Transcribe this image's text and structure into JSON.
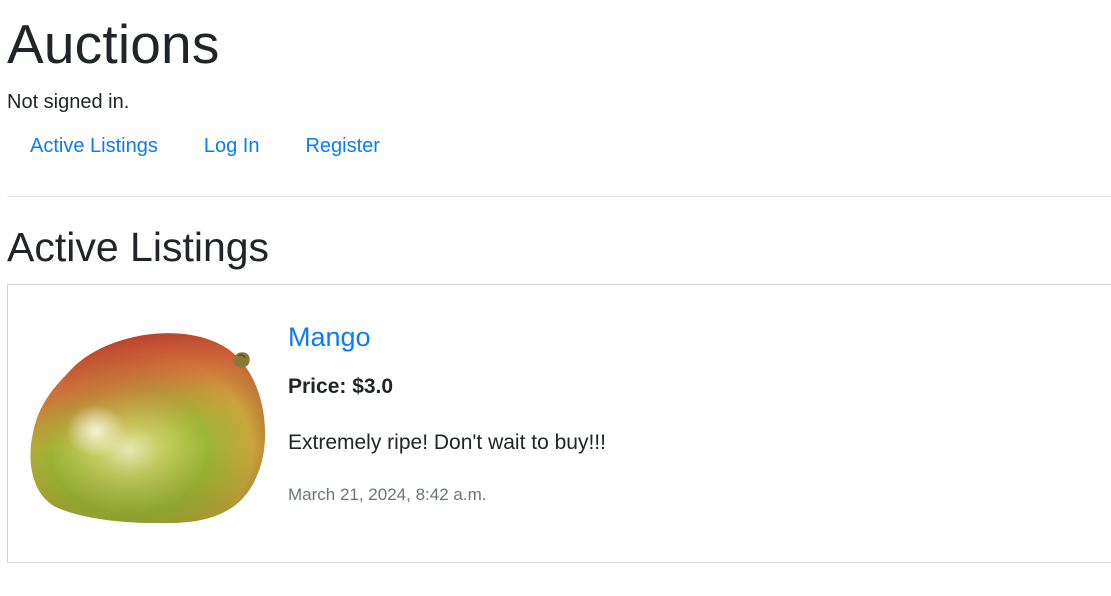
{
  "header": {
    "title": "Auctions",
    "signin_status": "Not signed in."
  },
  "nav": {
    "items": [
      {
        "label": "Active Listings"
      },
      {
        "label": "Log In"
      },
      {
        "label": "Register"
      }
    ],
    "link_color": "#0a7bff"
  },
  "main": {
    "section_title": "Active Listings",
    "listings": [
      {
        "title": "Mango",
        "image_icon": "mango-image",
        "price": "Price: $3.0",
        "description": "Extremely ripe! Don't wait to buy!!!",
        "date": "March 21, 2024, 8:42 a.m."
      }
    ]
  }
}
